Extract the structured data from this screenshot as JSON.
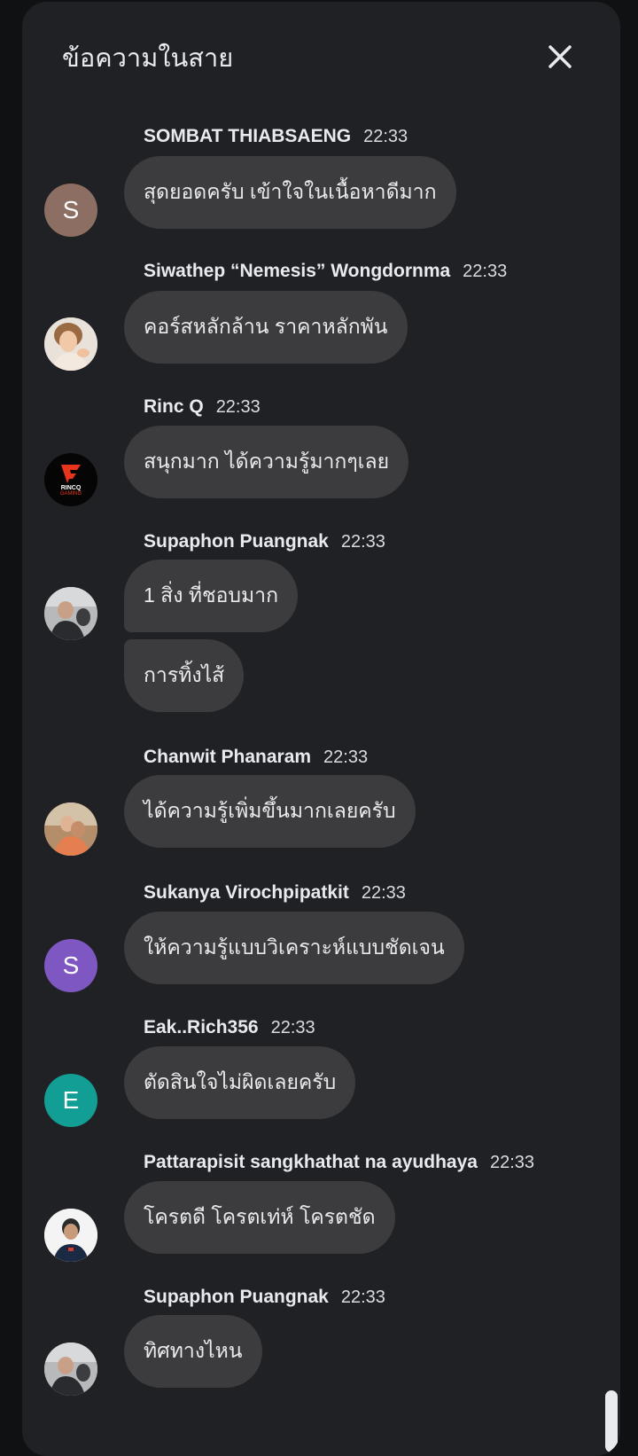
{
  "header": {
    "title": "ข้อความในสาย"
  },
  "messages": [
    {
      "sender": "SOMBAT THIABSAENG",
      "time": "22:33",
      "avatar": {
        "type": "letter",
        "letter": "S",
        "color": "#8d6e63"
      },
      "texts": [
        "สุดยอดครับ เข้าใจในเนื้อหาดีมาก"
      ]
    },
    {
      "sender": "Siwathep “Nemesis” Wongdornma",
      "time": "22:33",
      "avatar": {
        "type": "photo"
      },
      "texts": [
        "คอร์สหลักล้าน ราคาหลักพัน"
      ]
    },
    {
      "sender": "Rinc Q",
      "time": "22:33",
      "avatar": {
        "type": "logo",
        "logo_text": "RINCQ",
        "logo_sub": "GAMING"
      },
      "texts": [
        "สนุกมาก ได้ความรู้มากๆเลย"
      ]
    },
    {
      "sender": "Supaphon Puangnak",
      "time": "22:33",
      "avatar": {
        "type": "photo"
      },
      "texts": [
        "1 สิ่ง ที่ชอบมาก",
        "การทิ้งไส้"
      ]
    },
    {
      "sender": "Chanwit Phanaram",
      "time": "22:33",
      "avatar": {
        "type": "photo"
      },
      "texts": [
        "ได้ความรู้เพิ่มขึ้นมากเลยครับ"
      ]
    },
    {
      "sender": "Sukanya Virochpipatkit",
      "time": "22:33",
      "avatar": {
        "type": "letter",
        "letter": "S",
        "color": "#7e57c2"
      },
      "texts": [
        "ให้ความรู้แบบวิเคราะห์แบบชัดเจน"
      ]
    },
    {
      "sender": "Eak..Rich356",
      "time": "22:33",
      "avatar": {
        "type": "letter",
        "letter": "E",
        "color": "#129e94"
      },
      "texts": [
        "ตัดสินใจไม่ผิดเลยครับ"
      ]
    },
    {
      "sender": "Pattarapisit sangkhathat na ayudhaya",
      "time": "22:33",
      "avatar": {
        "type": "photo"
      },
      "texts": [
        "โครตดี โครตเท่ห์ โครตชัด"
      ]
    },
    {
      "sender": "Supaphon Puangnak",
      "time": "22:33",
      "avatar": {
        "type": "photo"
      },
      "texts": [
        "ทิศทางไหน"
      ]
    }
  ],
  "colors": {
    "background": "#0f1112",
    "panel": "#202124",
    "bubble": "#3c3c3f",
    "text": "#e8eaed"
  },
  "icons": {
    "close": "close-icon"
  }
}
